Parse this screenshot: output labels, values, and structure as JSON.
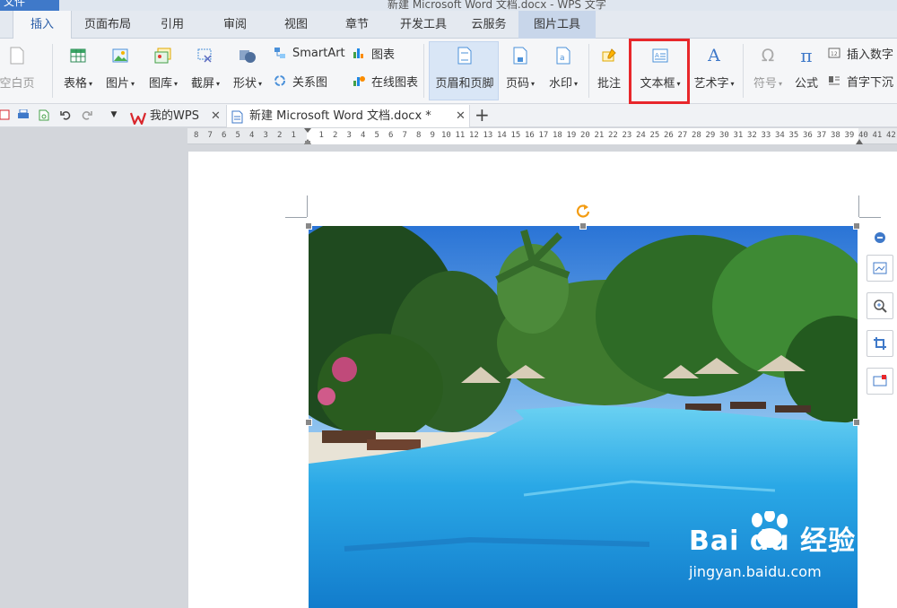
{
  "window": {
    "file_tab": "文件",
    "title": "新建 Microsoft Word 文档.docx - WPS 文字"
  },
  "menu_tabs": [
    {
      "label": "插入",
      "active": true
    },
    {
      "label": "页面布局"
    },
    {
      "label": "引用"
    },
    {
      "label": "审阅"
    },
    {
      "label": "视图"
    },
    {
      "label": "章节"
    },
    {
      "label": "开发工具"
    },
    {
      "label": "云服务"
    },
    {
      "label": "图片工具",
      "contextual": true
    }
  ],
  "ribbon": {
    "blank_page": "空白页",
    "table": "表格",
    "picture": "图片",
    "gallery": "图库",
    "screenshot": "截屏",
    "shapes": "形状",
    "smartart": "SmartArt",
    "relation": "关系图",
    "chart": "图表",
    "online_chart": "在线图表",
    "header_footer": "页眉和页脚",
    "page_number": "页码",
    "watermark": "水印",
    "comment": "批注",
    "textbox": "文本框",
    "wordart": "艺术字",
    "symbol": "符号",
    "formula": "公式",
    "insert_number": "插入数字",
    "dropcap": "首字下沉",
    "symbol_glyph": "Ω",
    "formula_glyph": "π",
    "wordart_glyph": "A"
  },
  "doc_tabs": [
    {
      "label": "我的WPS"
    },
    {
      "label": "新建 Microsoft Word 文档.docx *",
      "active": true
    }
  ],
  "ruler": {
    "left_numbers": [
      "8",
      "7",
      "6",
      "5",
      "4",
      "3",
      "2",
      "1"
    ],
    "right_numbers": [
      "1",
      "2",
      "3",
      "4",
      "5",
      "6",
      "7",
      "8",
      "9",
      "10",
      "11",
      "12",
      "13",
      "14",
      "15",
      "16",
      "17",
      "18",
      "19",
      "20",
      "21",
      "22",
      "23",
      "24",
      "25",
      "26",
      "27",
      "28",
      "29",
      "30",
      "31",
      "32",
      "33",
      "34",
      "35",
      "36",
      "37",
      "38",
      "39",
      "40",
      "41",
      "42"
    ]
  },
  "watermark": {
    "brand": "Bai du 经验",
    "url": "jingyan.baidu.com"
  },
  "colors": {
    "highlight": "#e8272b",
    "accent": "#2c5fa8",
    "wps_red": "#d9262c"
  }
}
